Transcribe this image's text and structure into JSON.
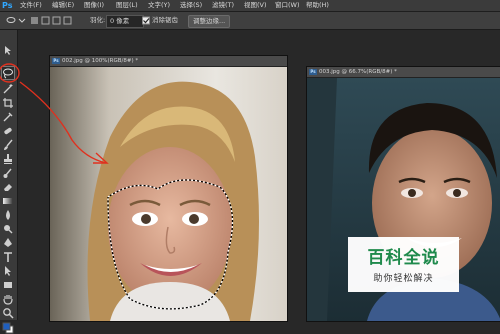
{
  "app": {
    "logo": "Ps"
  },
  "menubar": {
    "items": [
      "文件(F)",
      "编辑(E)",
      "图像(I)",
      "图层(L)",
      "文字(Y)",
      "选择(S)",
      "滤镜(T)",
      "视图(V)",
      "窗口(W)",
      "帮助(H)"
    ]
  },
  "options_bar": {
    "feather_label": "羽化:",
    "feather_value": "0 像素",
    "antialias_label": "消除锯齿",
    "antialias_checked": true,
    "refine_edge_button": "调整边缘..."
  },
  "documents": [
    {
      "title": "002.jpg @ 100%(RGB/8#) *",
      "icon": "Ps"
    },
    {
      "title": "003.jpg @ 66.7%(RGB/8#) *",
      "icon": "Ps"
    }
  ],
  "watermark": {
    "title": "百科全说",
    "subtitle": "助你轻松解决",
    "color": "#1f8a4c"
  },
  "annotation": {
    "color": "#e0301e"
  },
  "icons": [
    "move-icon",
    "lasso-icon",
    "magic-wand-icon",
    "crop-icon",
    "eyedropper-icon",
    "healing-brush-icon",
    "brush-icon",
    "clone-stamp-icon",
    "history-brush-icon",
    "eraser-icon",
    "gradient-icon",
    "blur-icon",
    "dodge-icon",
    "pen-icon",
    "type-icon",
    "path-select-icon",
    "shape-icon",
    "hand-icon",
    "zoom-icon"
  ]
}
